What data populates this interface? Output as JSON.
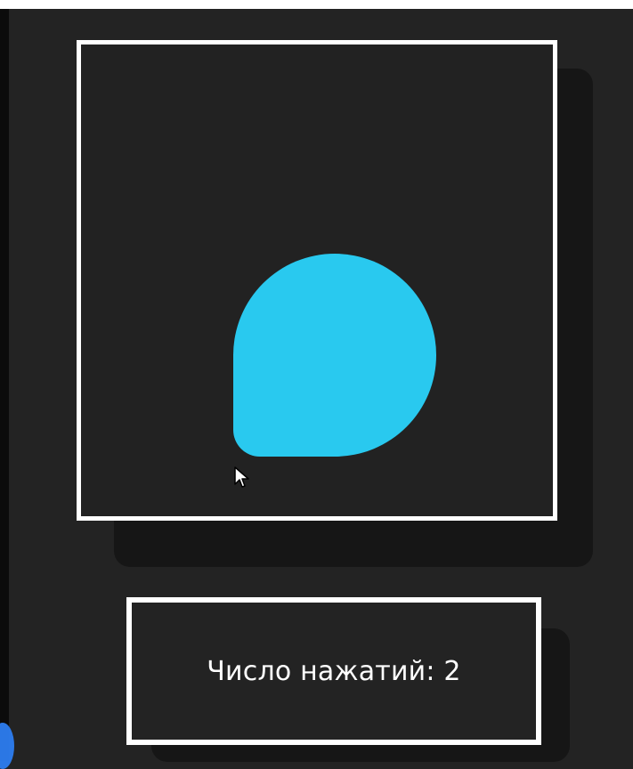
{
  "counter": {
    "text": "Число нажатий: 2"
  },
  "colors": {
    "background": "#232323",
    "panel": "#222222",
    "border": "#ffffff",
    "blob": "#29c9ef",
    "shadow": "#161616"
  },
  "icons": {
    "cursor": "mouse-pointer-icon"
  }
}
